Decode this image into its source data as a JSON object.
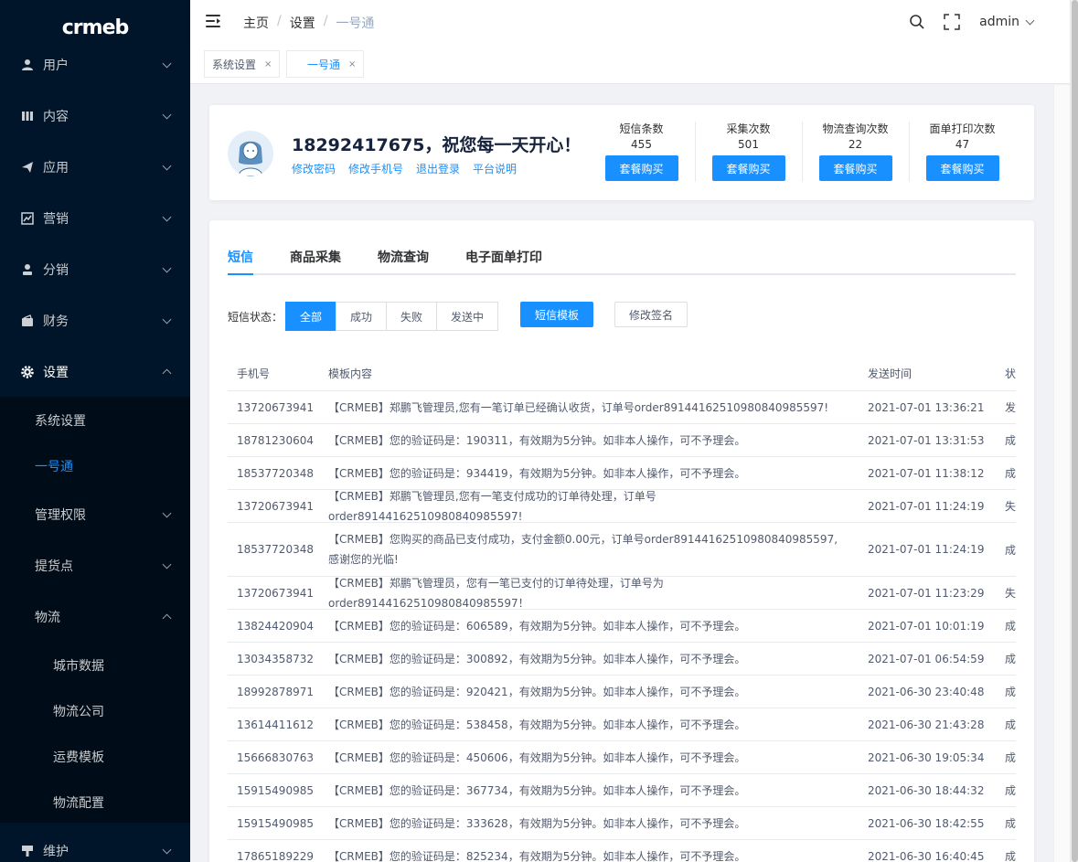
{
  "logo": {
    "text": "crmeb"
  },
  "sidebar": {
    "items": [
      {
        "label": "用户",
        "icon": "user-icon"
      },
      {
        "label": "内容",
        "icon": "content-icon"
      },
      {
        "label": "应用",
        "icon": "send-icon"
      },
      {
        "label": "营销",
        "icon": "chart-icon"
      },
      {
        "label": "分销",
        "icon": "person-icon"
      },
      {
        "label": "财务",
        "icon": "wallet-icon"
      },
      {
        "label": "设置",
        "icon": "gear-icon"
      }
    ],
    "settings_sub": [
      {
        "label": "系统设置"
      },
      {
        "label": "一号通"
      },
      {
        "label": "管理权限"
      },
      {
        "label": "提货点"
      },
      {
        "label": "物流"
      }
    ],
    "logistics_sub": [
      {
        "label": "城市数据"
      },
      {
        "label": "物流公司"
      },
      {
        "label": "运费模板"
      },
      {
        "label": "物流配置"
      }
    ],
    "maintain": {
      "label": "维护",
      "icon": "tool-icon"
    }
  },
  "header": {
    "breadcrumb": [
      "主页",
      "设置",
      "一号通"
    ],
    "separator": "/",
    "user": "admin"
  },
  "tags": [
    {
      "label": "系统设置",
      "close": "×"
    },
    {
      "label": "一号通",
      "close": "×"
    }
  ],
  "account": {
    "welcome": "18292417675，祝您每一天开心！",
    "links": [
      "修改密码",
      "修改手机号",
      "退出登录",
      "平台说明"
    ],
    "stats": [
      {
        "label": "短信条数",
        "value": "455",
        "button": "套餐购买"
      },
      {
        "label": "采集次数",
        "value": "501",
        "button": "套餐购买"
      },
      {
        "label": "物流查询次数",
        "value": "22",
        "button": "套餐购买"
      },
      {
        "label": "面单打印次数",
        "value": "47",
        "button": "套餐购买"
      }
    ]
  },
  "tabs": [
    "短信",
    "商品采集",
    "物流查询",
    "电子面单打印"
  ],
  "filter": {
    "label": "短信状态：",
    "options": [
      "全部",
      "成功",
      "失败",
      "发送中"
    ],
    "template_button": "短信模板",
    "signature_button": "修改签名"
  },
  "table": {
    "columns": [
      "手机号",
      "模板内容",
      "发送时间",
      "状"
    ],
    "rows": [
      {
        "phone": "13720673941",
        "content": "【CRMEB】郑鹏飞管理员,您有一笔订单已经确认收货，订单号order89144162510980840985597!",
        "time": "2021-07-01 13:36:21",
        "status": "发"
      },
      {
        "phone": "18781230604",
        "content": "【CRMEB】您的验证码是：190311，有效期为5分钟。如非本人操作，可不予理会。",
        "time": "2021-07-01 13:31:53",
        "status": "成"
      },
      {
        "phone": "18537720348",
        "content": "【CRMEB】您的验证码是：934419，有效期为5分钟。如非本人操作，可不予理会。",
        "time": "2021-07-01 11:38:12",
        "status": "成"
      },
      {
        "phone": "13720673941",
        "content": "【CRMEB】郑鹏飞管理员,您有一笔支付成功的订单待处理，订单号order89144162510980840985597!",
        "time": "2021-07-01 11:24:19",
        "status": "失"
      },
      {
        "phone": "18537720348",
        "content": "【CRMEB】您购买的商品已支付成功，支付金额0.00元，订单号order89144162510980840985597,感谢您的光临!",
        "time": "2021-07-01 11:24:19",
        "status": "成"
      },
      {
        "phone": "13720673941",
        "content": "【CRMEB】郑鹏飞管理员，您有一笔已支付的订单待处理，订单号为order89144162510980840985597！",
        "time": "2021-07-01 11:23:29",
        "status": "失"
      },
      {
        "phone": "13824420904",
        "content": "【CRMEB】您的验证码是：606589，有效期为5分钟。如非本人操作，可不予理会。",
        "time": "2021-07-01 10:01:19",
        "status": "成"
      },
      {
        "phone": "13034358732",
        "content": "【CRMEB】您的验证码是：300892，有效期为5分钟。如非本人操作，可不予理会。",
        "time": "2021-07-01 06:54:59",
        "status": "成"
      },
      {
        "phone": "18992878971",
        "content": "【CRMEB】您的验证码是：920421，有效期为5分钟。如非本人操作，可不予理会。",
        "time": "2021-06-30 23:40:48",
        "status": "成"
      },
      {
        "phone": "13614411612",
        "content": "【CRMEB】您的验证码是：538458，有效期为5分钟。如非本人操作，可不予理会。",
        "time": "2021-06-30 21:43:28",
        "status": "成"
      },
      {
        "phone": "15666830763",
        "content": "【CRMEB】您的验证码是：450606，有效期为5分钟。如非本人操作，可不予理会。",
        "time": "2021-06-30 19:05:34",
        "status": "成"
      },
      {
        "phone": "15915490985",
        "content": "【CRMEB】您的验证码是：367734，有效期为5分钟。如非本人操作，可不予理会。",
        "time": "2021-06-30 18:44:32",
        "status": "成"
      },
      {
        "phone": "15915490985",
        "content": "【CRMEB】您的验证码是：333628，有效期为5分钟。如非本人操作，可不予理会。",
        "time": "2021-06-30 18:42:55",
        "status": "成"
      },
      {
        "phone": "17865189229",
        "content": "【CRMEB】您的验证码是：825234，有效期为5分钟。如非本人操作，可不予理会。",
        "time": "2021-06-30 16:40:45",
        "status": "成"
      }
    ]
  },
  "colors": {
    "primary": "#1890ff",
    "sidebar": "#001529",
    "submenu": "#000c17"
  }
}
